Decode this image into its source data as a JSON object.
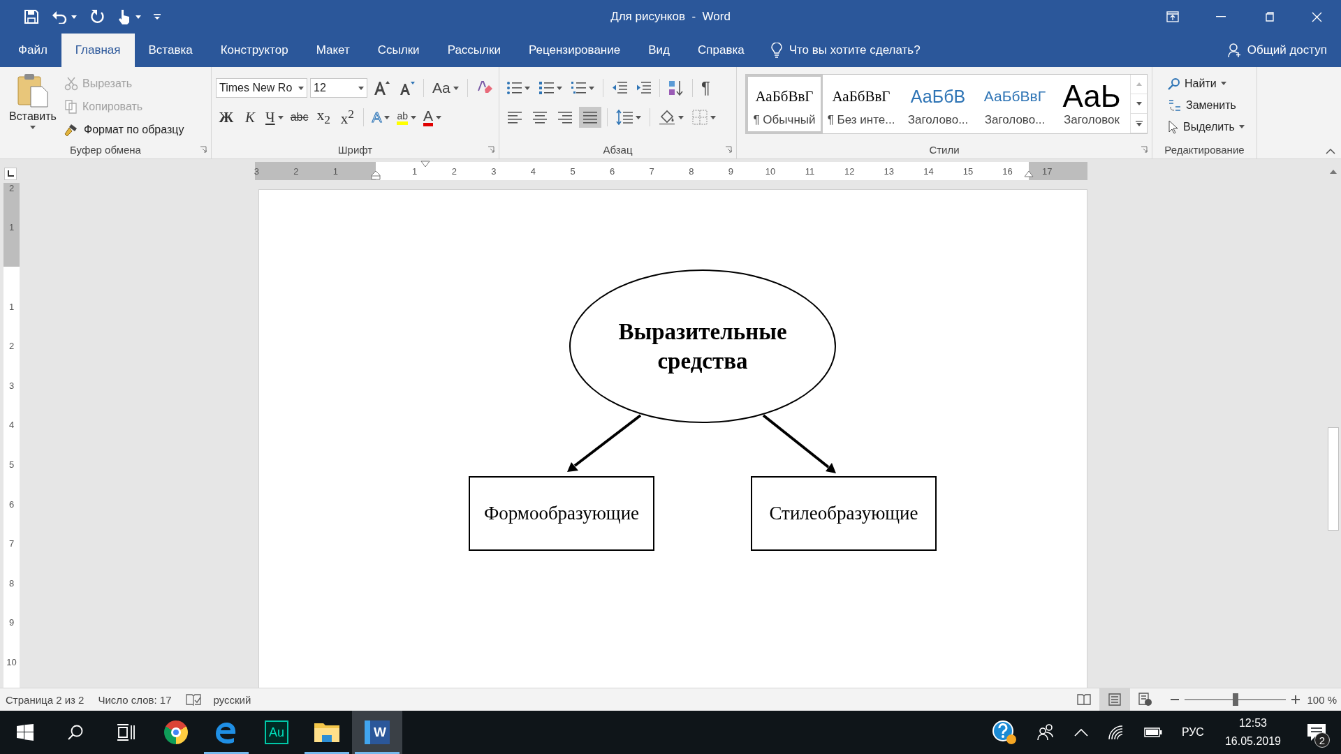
{
  "window": {
    "title": "Для рисунков  -  Word"
  },
  "tabs": [
    {
      "label": "Файл",
      "selected": false
    },
    {
      "label": "Главная",
      "selected": true
    },
    {
      "label": "Вставка",
      "selected": false
    },
    {
      "label": "Конструктор",
      "selected": false
    },
    {
      "label": "Макет",
      "selected": false
    },
    {
      "label": "Ссылки",
      "selected": false
    },
    {
      "label": "Рассылки",
      "selected": false
    },
    {
      "label": "Рецензирование",
      "selected": false
    },
    {
      "label": "Вид",
      "selected": false
    },
    {
      "label": "Справка",
      "selected": false
    }
  ],
  "tell_me": "Что вы хотите сделать?",
  "share": "Общий доступ",
  "ribbon": {
    "clipboard": {
      "title": "Буфер обмена",
      "paste": "Вставить",
      "items": [
        {
          "kind": "cut",
          "label": "Вырезать",
          "disabled": true
        },
        {
          "kind": "copy",
          "label": "Копировать",
          "disabled": true
        },
        {
          "kind": "painter",
          "label": "Формат по образцу",
          "disabled": false
        }
      ]
    },
    "font": {
      "title": "Шрифт",
      "font_name": "Times New Ro",
      "font_size": "12",
      "change_case": "Aa",
      "format_buttons": [
        {
          "kind": "bold",
          "label": "Ж"
        },
        {
          "kind": "italic",
          "label": "К"
        },
        {
          "kind": "underline",
          "label": "Ч"
        },
        {
          "kind": "strike",
          "label": "abc"
        },
        {
          "kind": "sub",
          "label": "x$_{2}$"
        },
        {
          "kind": "sup",
          "label": "x$^{2}$"
        }
      ],
      "effects_label": "A",
      "highlight_label": "ab",
      "font_color_label": "A"
    },
    "paragraph": {
      "title": "Абзац",
      "show_marks": "¶",
      "alignments": [
        {
          "selected": false
        },
        {
          "selected": false
        },
        {
          "selected": false
        },
        {
          "selected": true
        }
      ]
    },
    "styles": {
      "title": "Стили",
      "items": [
        {
          "kind": "normal",
          "sample": "АаБбВвГ",
          "name": "¶ Обычный",
          "selected": true
        },
        {
          "kind": "nospacing",
          "sample": "АаБбВвГ",
          "name": "¶ Без инте...",
          "selected": false
        },
        {
          "kind": "heading1",
          "sample": "АаБбВ",
          "name": "Заголово...",
          "selected": false
        },
        {
          "kind": "heading2",
          "sample": "АаБбВвГ",
          "name": "Заголово...",
          "selected": false
        },
        {
          "kind": "title",
          "sample": "АаЬ",
          "name": "Заголовок",
          "selected": false
        }
      ]
    },
    "editing": {
      "title": "Редактирование",
      "items": [
        {
          "kind": "find",
          "label": "Найти"
        },
        {
          "kind": "replace",
          "label": "Заменить"
        },
        {
          "kind": "select",
          "label": "Выделить"
        }
      ]
    }
  },
  "ruler": {
    "left_numbers": [
      "3",
      "2",
      "1"
    ],
    "numbers": [
      "1",
      "2",
      "3",
      "4",
      "5",
      "6",
      "7",
      "8",
      "9",
      "10",
      "11",
      "12",
      "13",
      "14",
      "15",
      "16",
      "17"
    ]
  },
  "vertical_ruler": {
    "top_numbers": [
      "2",
      "1"
    ],
    "numbers": [
      "1",
      "2",
      "3",
      "4",
      "5",
      "6",
      "7",
      "8",
      "9",
      "10"
    ]
  },
  "document": {
    "ellipse": "Выразительные средства",
    "boxes": [
      "Формообразующие",
      "Стилеобразующие"
    ]
  },
  "status_bar": {
    "page": "Страница 2 из 2",
    "words": "Число слов: 17",
    "language": "русский",
    "views": [
      {
        "selected": false
      },
      {
        "selected": true
      },
      {
        "selected": false
      }
    ],
    "zoom": {
      "level": 0.5,
      "reading": "100 %"
    }
  },
  "taskbar": {
    "apps": [
      {
        "kind": "chrome",
        "running": false,
        "active": false
      },
      {
        "kind": "edge",
        "running": true,
        "active": false
      },
      {
        "kind": "audition",
        "label": "Au",
        "running": false,
        "active": false
      },
      {
        "kind": "explorer",
        "running": true,
        "active": false
      },
      {
        "kind": "word",
        "label": "W",
        "running": true,
        "active": true
      }
    ],
    "language": "РУС",
    "time": "12:53",
    "date": "16.05.2019",
    "notifications": "2"
  }
}
